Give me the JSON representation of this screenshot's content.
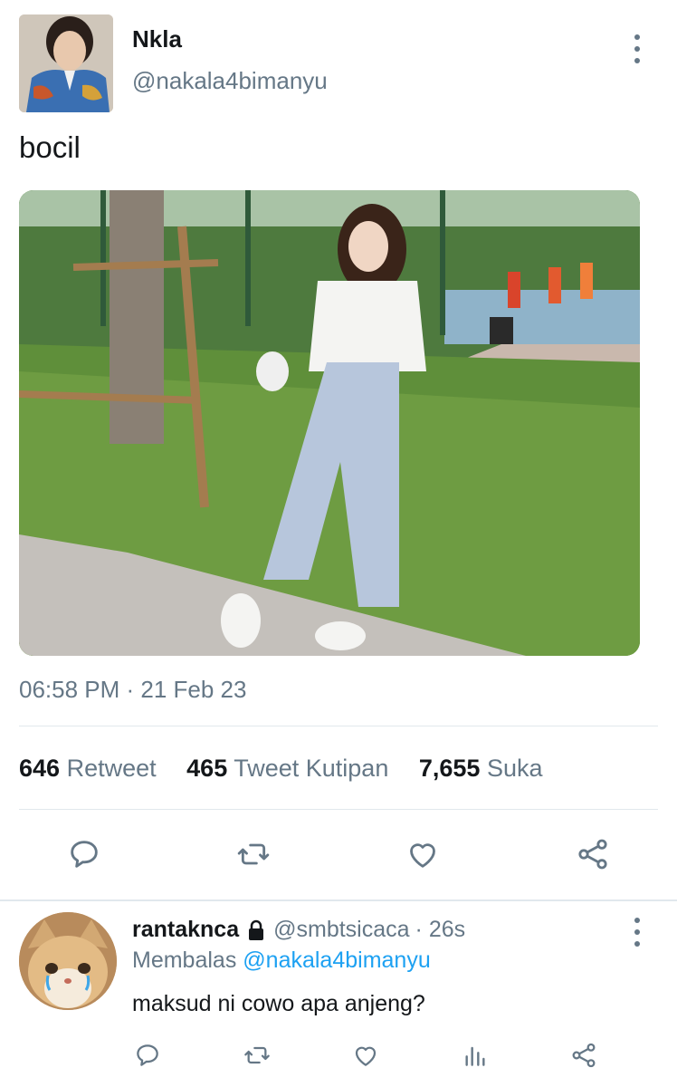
{
  "tweet": {
    "author_name": "Nkla",
    "author_handle": "@nakala4bimanyu",
    "text": "bocil",
    "timestamp": "06:58 PM · 21 Feb 23"
  },
  "stats": {
    "retweets_count": "646",
    "retweets_label": "Retweet",
    "quotes_count": "465",
    "quotes_label": "Tweet Kutipan",
    "likes_count": "7,655",
    "likes_label": "Suka"
  },
  "actions": [
    "reply-icon",
    "retweet-icon",
    "like-icon",
    "share-icon"
  ],
  "reply": {
    "author_name": "rantaknca",
    "author_handle": "@smbtsicaca",
    "time": "· 26s",
    "replying_prefix": "Membalas",
    "replying_to": "@nakala4bimanyu",
    "text": "maksud ni cowo apa anjeng?",
    "actions": [
      "reply-icon",
      "retweet-icon",
      "like-icon",
      "analytics-icon",
      "share-icon"
    ]
  },
  "colors": {
    "text_primary": "#14171a",
    "text_secondary": "#657786",
    "link": "#1da1f2",
    "divider": "#e1e8ed"
  }
}
